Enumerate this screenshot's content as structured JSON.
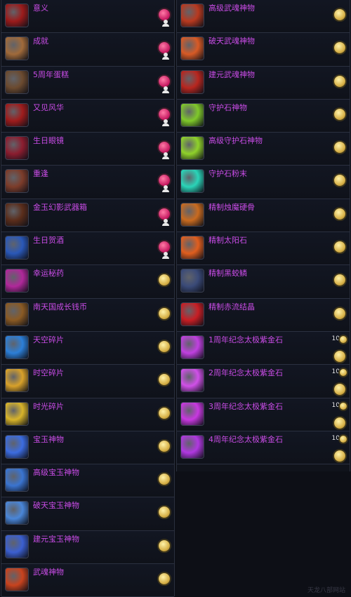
{
  "left_items": [
    {
      "name": "意义",
      "currency": "pink",
      "icon_color": "#9b1b1b",
      "person": true
    },
    {
      "name": "成就",
      "currency": "pink",
      "icon_color": "#a06a3a",
      "person": true
    },
    {
      "name": "5周年蛋糕",
      "currency": "pink",
      "icon_color": "#6b4a2f",
      "person": true
    },
    {
      "name": "又见风华",
      "currency": "pink",
      "icon_color": "#9e1c1c",
      "person": true
    },
    {
      "name": "生日眼镜",
      "currency": "pink",
      "icon_color": "#8b1d2f",
      "person": true
    },
    {
      "name": "重逢",
      "currency": "pink",
      "icon_color": "#7c3c2a",
      "person": true
    },
    {
      "name": "金玉幻影武器箱",
      "currency": "pink",
      "icon_color": "#5a2d1b",
      "person": true
    },
    {
      "name": "生日贺酒",
      "currency": "pink",
      "icon_color": "#2a58b8",
      "person": true
    },
    {
      "name": "幸运秘药",
      "currency": "gold",
      "icon_color": "#b0289a",
      "person": false
    },
    {
      "name": "南天国成长钱币",
      "currency": "gold",
      "icon_color": "#8a5a24",
      "person": false
    },
    {
      "name": "天空碎片",
      "currency": "gold",
      "icon_color": "#2c7fd8",
      "person": false
    },
    {
      "name": "时空碎片",
      "currency": "gold",
      "icon_color": "#d8a12a",
      "person": false
    },
    {
      "name": "时光碎片",
      "currency": "gold",
      "icon_color": "#d8b42a",
      "person": false
    },
    {
      "name": "宝玉神物",
      "currency": "gold",
      "icon_color": "#3c6ce0",
      "person": false
    },
    {
      "name": "高级宝玉神物",
      "currency": "gold",
      "icon_color": "#3a74d0",
      "person": false
    },
    {
      "name": "破天宝玉神物",
      "currency": "gold",
      "icon_color": "#4a86d8",
      "person": false
    },
    {
      "name": "建元宝玉神物",
      "currency": "gold",
      "icon_color": "#3b5fd0",
      "person": false
    },
    {
      "name": "武魂神物",
      "currency": "gold",
      "icon_color": "#c8431e",
      "person": false
    }
  ],
  "right_items": [
    {
      "name": "高级武魂神物",
      "currency": "gold",
      "icon_color": "#b8391f",
      "qty": ""
    },
    {
      "name": "破天武魂神物",
      "currency": "gold",
      "icon_color": "#d85a25",
      "qty": ""
    },
    {
      "name": "建元武魂神物",
      "currency": "gold",
      "icon_color": "#b8261f",
      "qty": ""
    },
    {
      "name": "守护石神物",
      "currency": "gold",
      "icon_color": "#7fc82a",
      "qty": ""
    },
    {
      "name": "高级守护石神物",
      "currency": "gold",
      "icon_color": "#8fd12a",
      "qty": ""
    },
    {
      "name": "守护石粉末",
      "currency": "gold",
      "icon_color": "#2ad4b8",
      "qty": ""
    },
    {
      "name": "精制烛魔硬骨",
      "currency": "gold",
      "icon_color": "#c86a1f",
      "qty": ""
    },
    {
      "name": "精制太阳石",
      "currency": "gold",
      "icon_color": "#e05e1e",
      "qty": ""
    },
    {
      "name": "精制黑蛟鳞",
      "currency": "gold",
      "icon_color": "#3a4a78",
      "qty": ""
    },
    {
      "name": "精制赤流结晶",
      "currency": "gold",
      "icon_color": "#c81e24",
      "qty": ""
    },
    {
      "name": "1周年纪念太极紫金石",
      "currency": "gold-stack",
      "icon_color": "#c040e0",
      "qty": "10"
    },
    {
      "name": "2周年纪念太极紫金石",
      "currency": "gold-stack",
      "icon_color": "#d050e8",
      "qty": "10"
    },
    {
      "name": "3周年纪念太极紫金石",
      "currency": "gold-stack",
      "icon_color": "#c838e0",
      "qty": "10"
    },
    {
      "name": "4周年纪念太极紫金石",
      "currency": "gold-stack",
      "icon_color": "#b038e0",
      "qty": "10"
    }
  ],
  "watermark": "天龙八部网站"
}
